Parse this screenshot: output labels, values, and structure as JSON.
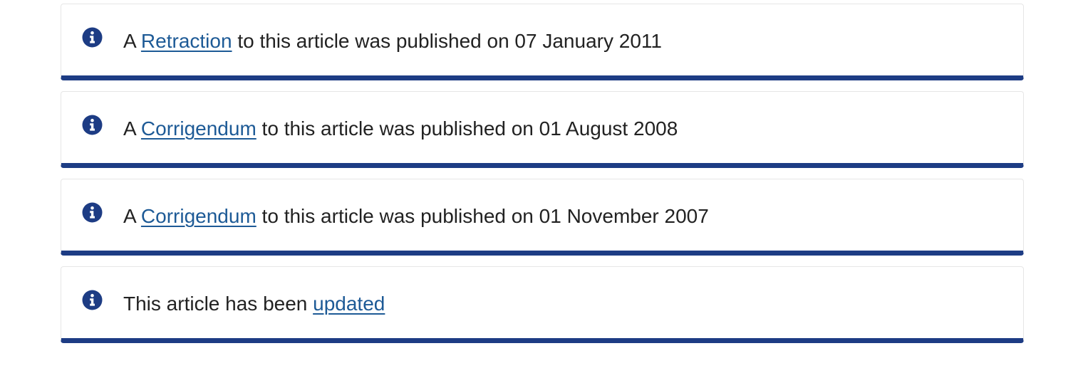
{
  "colors": {
    "accent_bar": "#1d3c84",
    "icon": "#1d3c84",
    "link": "#1d5a96",
    "text": "#222222"
  },
  "notices": [
    {
      "icon": "info-circle-icon",
      "prefix": "A ",
      "link": "Retraction",
      "suffix": " to this article was published on 07 January 2011"
    },
    {
      "icon": "info-circle-icon",
      "prefix": "A ",
      "link": "Corrigendum",
      "suffix": " to this article was published on 01 August 2008"
    },
    {
      "icon": "info-circle-icon",
      "prefix": "A ",
      "link": "Corrigendum",
      "suffix": " to this article was published on 01 November 2007"
    },
    {
      "icon": "info-circle-icon",
      "prefix": "This article has been ",
      "link": "updated",
      "suffix": ""
    }
  ]
}
